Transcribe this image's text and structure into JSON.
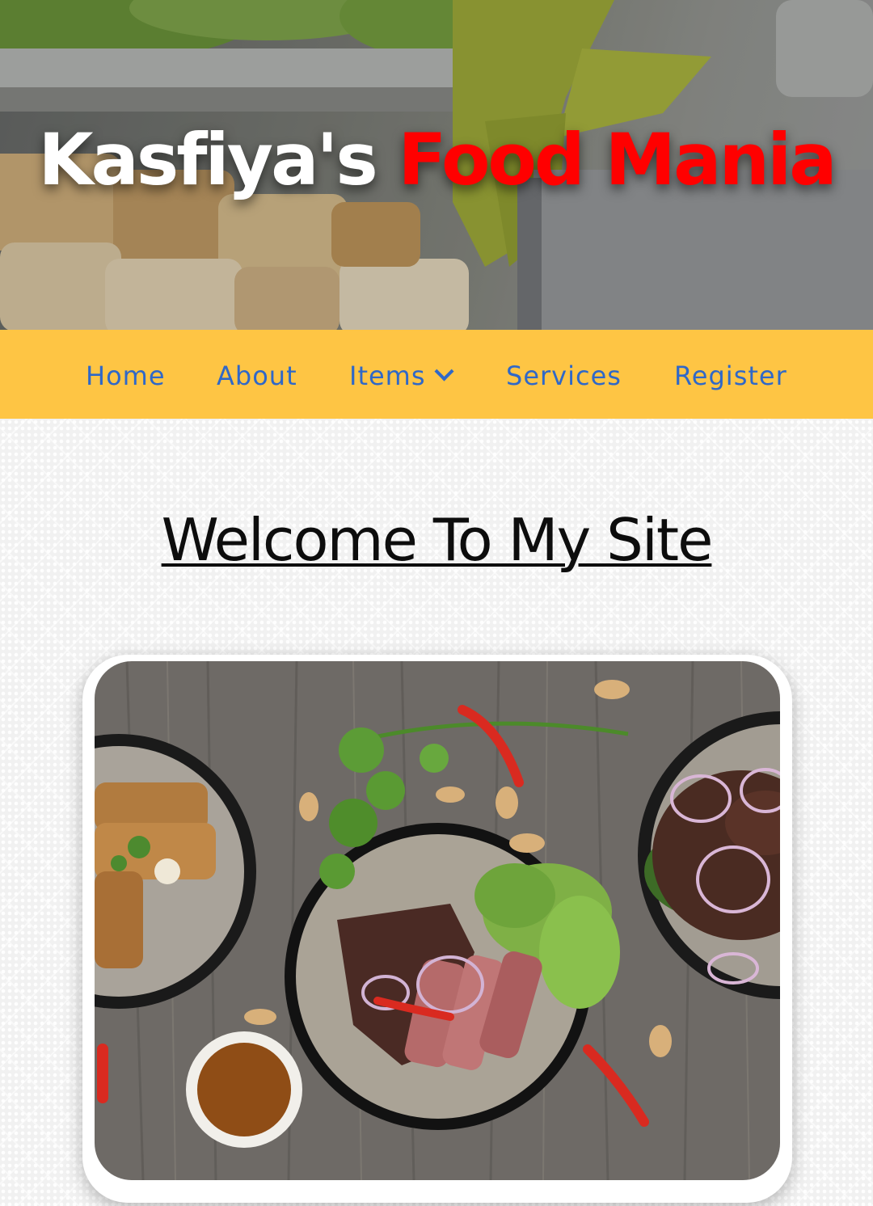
{
  "header": {
    "title_part1": "Kasfiya's",
    "title_part2": "Food Mania",
    "title_color_primary": "#ffffff",
    "title_color_accent": "#ff0000",
    "background_image": "salad-header-photo"
  },
  "nav": {
    "background_color": "#fec544",
    "link_color": "#2f68c8",
    "items": [
      {
        "label": "Home"
      },
      {
        "label": "About"
      },
      {
        "label": "Items",
        "has_dropdown": true,
        "icon": "chevron-down-icon"
      },
      {
        "label": "Services"
      },
      {
        "label": "Register"
      }
    ]
  },
  "main": {
    "heading": "Welcome To My Site",
    "featured_image": "food-bowls-photo"
  }
}
